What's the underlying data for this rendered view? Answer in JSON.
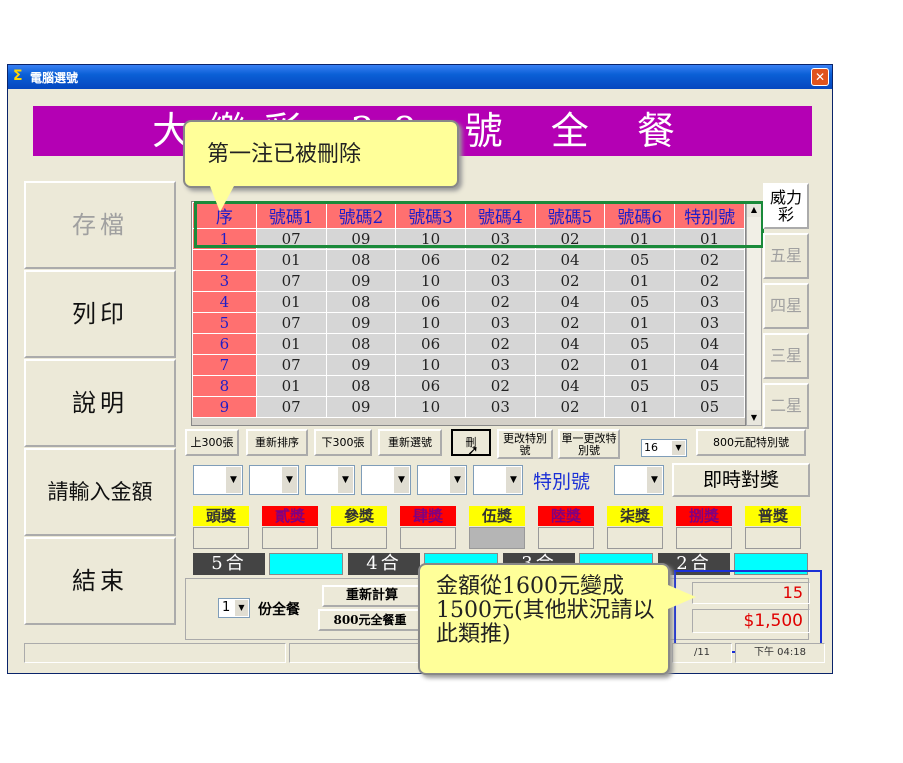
{
  "window": {
    "title": "電腦選號",
    "close": "✕"
  },
  "banner": {
    "text": "大樂彩 38 號 全 餐"
  },
  "left_buttons": [
    {
      "label": "存檔",
      "disabled": true
    },
    {
      "label": "列印",
      "disabled": false
    },
    {
      "label": "說明",
      "disabled": false
    },
    {
      "label": "請輸入金額",
      "disabled": false
    },
    {
      "label": "結束",
      "disabled": false
    }
  ],
  "grid": {
    "headers": [
      "序",
      "號碼1",
      "號碼2",
      "號碼3",
      "號碼4",
      "號碼5",
      "號碼6",
      "特別號"
    ],
    "rows": [
      [
        "1",
        "07",
        "09",
        "10",
        "03",
        "02",
        "01",
        "01"
      ],
      [
        "2",
        "01",
        "08",
        "06",
        "02",
        "04",
        "05",
        "02"
      ],
      [
        "3",
        "07",
        "09",
        "10",
        "03",
        "02",
        "01",
        "02"
      ],
      [
        "4",
        "01",
        "08",
        "06",
        "02",
        "04",
        "05",
        "03"
      ],
      [
        "5",
        "07",
        "09",
        "10",
        "03",
        "02",
        "01",
        "03"
      ],
      [
        "6",
        "01",
        "08",
        "06",
        "02",
        "04",
        "05",
        "04"
      ],
      [
        "7",
        "07",
        "09",
        "10",
        "03",
        "02",
        "01",
        "04"
      ],
      [
        "8",
        "01",
        "08",
        "06",
        "02",
        "04",
        "05",
        "05"
      ],
      [
        "9",
        "07",
        "09",
        "10",
        "03",
        "02",
        "01",
        "05"
      ]
    ]
  },
  "side_buttons": [
    "威力彩",
    "五星",
    "四星",
    "三星",
    "二星"
  ],
  "toolbar": {
    "prev300": "上300張",
    "resort": "重新排序",
    "next300": "下300張",
    "reselect": "重新選號",
    "delete": "刪",
    "change_special": "更改特別號",
    "single_change_special": "單一更改特別號",
    "count_value": "16",
    "special800": "800元配特別號"
  },
  "special_label": "特別號",
  "check_button": "即時對獎",
  "prizes": [
    "頭獎",
    "貳獎",
    "參獎",
    "肆獎",
    "伍獎",
    "陸獎",
    "柒獎",
    "捌獎",
    "普獎"
  ],
  "hits": [
    "5合",
    "4合",
    "3合",
    "2合"
  ],
  "bottom": {
    "portion_value": "1",
    "portion_label": "份全餐",
    "recalc": "重新計算",
    "meal800": "800元全餐重",
    "count": "15",
    "amount": "$1,500",
    "status_date": "/11",
    "status_time": "下午 04:18"
  },
  "callouts": {
    "top": "第一注已被刪除",
    "bottom": "金額從1600元變成1500元(其他狀況請以此類推)"
  },
  "colors": {
    "banner": "#b400b4",
    "header_cell": "#ff7070",
    "highlight_green": "#1a8a3a",
    "highlight_blue": "#1a2fd6"
  }
}
